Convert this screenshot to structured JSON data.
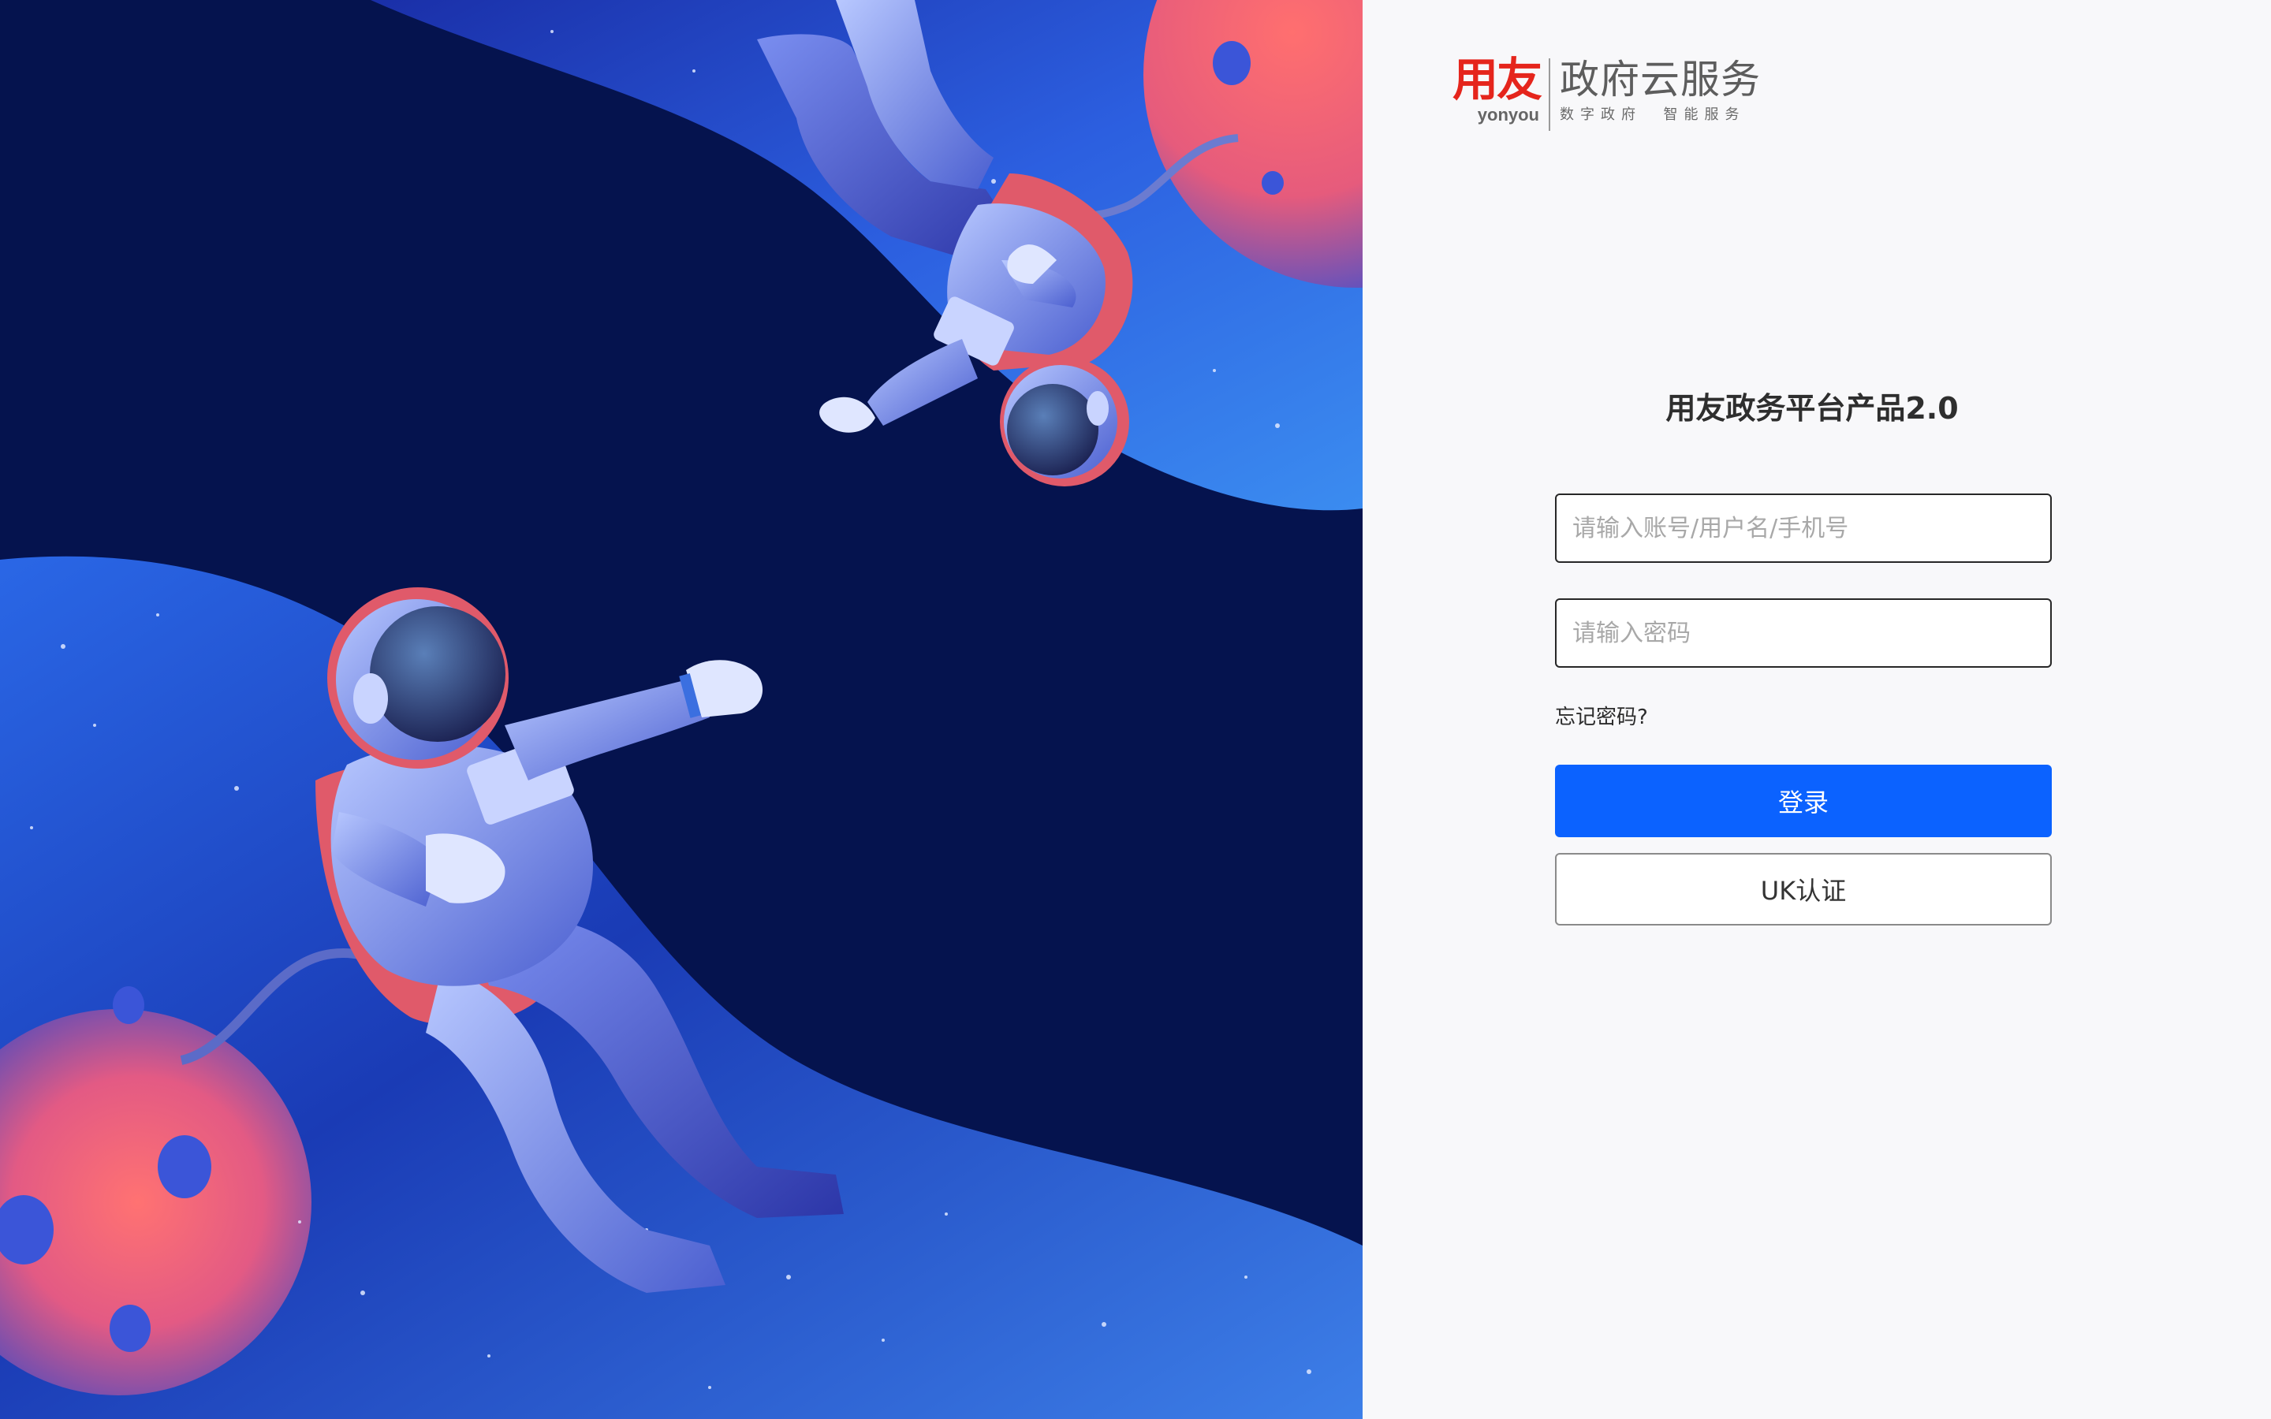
{
  "logo": {
    "mark": "用友",
    "latin": "yonyou",
    "title": "政府云服务",
    "slogan": "数字政府  智能服务"
  },
  "login": {
    "title": "用友政务平台产品2.0",
    "account_placeholder": "请输入账号/用户名/手机号",
    "password_placeholder": "请输入密码",
    "forgot_label": "忘记密码?",
    "login_label": "登录",
    "uk_label": "UK认证"
  },
  "colors": {
    "primary": "#0b62ff",
    "brand_red": "#e5251c",
    "space_bg": "#05134e"
  },
  "illustration": {
    "subject": "two astronauts floating in space with planets"
  }
}
